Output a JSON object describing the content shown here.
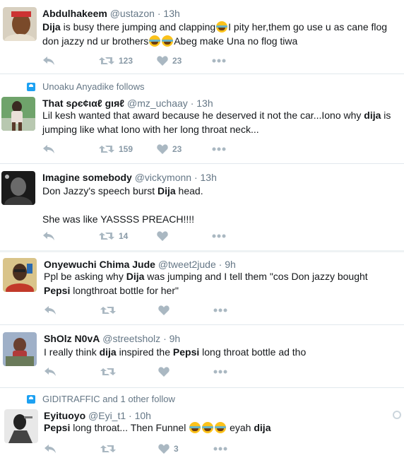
{
  "tweets": [
    {
      "name": "Abdulhakeem",
      "handle": "@ustazon",
      "time": "13h",
      "lines": [
        [
          {
            "t": "Dija",
            "b": true
          },
          {
            "t": " is busy there jumping and clapping"
          },
          {
            "e": 1
          },
          {
            "t": "I pity her,them go use u as cane flog"
          }
        ],
        [
          {
            "t": "don jazzy nd ur brothers"
          },
          {
            "e": 2
          },
          {
            "t": "Abeg make Una no flog tiwa"
          }
        ]
      ],
      "retweets": "123",
      "likes": "23",
      "avatar_colors": [
        "#c8a27a",
        "#7a4a2a",
        "#d8d0c0"
      ]
    },
    {
      "context": "Unoaku Anyadike follows",
      "name": "That ѕρє¢ιαℓ gιяℓ",
      "handle": "@mz_uchaay",
      "time": "13h",
      "lines": [
        [
          {
            "t": "Lil kesh wanted that award because he deserved it not the car...Iono why "
          },
          {
            "t": "dija",
            "b": true
          },
          {
            "t": " is"
          }
        ],
        [
          {
            "t": "jumping like what Iono with her long throat neck..."
          }
        ]
      ],
      "retweets": "159",
      "likes": "23",
      "avatar_colors": [
        "#6fa36b",
        "#3a2a22",
        "#e9d8c8"
      ]
    },
    {
      "name": "Imagine somebody",
      "handle": "@vickymonn",
      "time": "13h",
      "lines": [
        [
          {
            "t": "Don Jazzy's speech burst "
          },
          {
            "t": "Dija",
            "b": true
          },
          {
            "t": " head."
          }
        ],
        [],
        [
          {
            "t": "She was like YASSSS PREACH!!!!"
          }
        ]
      ],
      "retweets": "14",
      "likes": "",
      "avatar_colors": [
        "#2a2a2a",
        "#8a8a8a",
        "#111111"
      ]
    },
    {
      "name": "Onyewuchi Chima Jude",
      "handle": "@tweet2jude",
      "time": "9h",
      "lines": [
        [
          {
            "t": "Ppl be asking why "
          },
          {
            "t": "Dija",
            "b": true
          },
          {
            "t": " was jumping and I tell them \"cos Don jazzy bought"
          }
        ],
        [
          {
            "t": "Pepsi",
            "b": true
          },
          {
            "t": " longthroat bottle for her\""
          }
        ]
      ],
      "retweets": "",
      "likes": "",
      "avatar_colors": [
        "#d9b54a",
        "#4a3020",
        "#c23a2a"
      ]
    },
    {
      "name": "ShOlz N0vA",
      "handle": "@streetsholz",
      "time": "9h",
      "lines": [
        [
          {
            "t": "I really think "
          },
          {
            "t": "dija",
            "b": true
          },
          {
            "t": " inspired the "
          },
          {
            "t": "Pepsi",
            "b": true
          },
          {
            "t": " long throat bottle ad tho"
          }
        ]
      ],
      "retweets": "",
      "likes": "",
      "avatar_colors": [
        "#9fb0c8",
        "#b03a3a",
        "#6a7a5a"
      ]
    },
    {
      "context": "GIDITRAFFIC and 1 other follow",
      "name": "Eyituoyo",
      "handle": "@Eyi_t1",
      "time": "10h",
      "lines": [
        [
          {
            "t": "Pepsi",
            "b": true
          },
          {
            "t": " long throat... Then Funnel "
          },
          {
            "e": 3
          },
          {
            "t": "  eyah "
          },
          {
            "t": "dija",
            "b": true
          }
        ]
      ],
      "retweets": "",
      "likes": "3",
      "avatar_colors": [
        "#e8e8e8",
        "#222222",
        "#777777"
      ]
    }
  ],
  "colors": {
    "separator": "#e1e8ed",
    "action_icon": "#aab8c2",
    "muted_text": "#657786",
    "context_icon": "#1da1f2"
  },
  "icons": [
    "reply-icon",
    "retweet-icon",
    "heart-icon",
    "more-icon",
    "people-icon",
    "globe-icon"
  ]
}
